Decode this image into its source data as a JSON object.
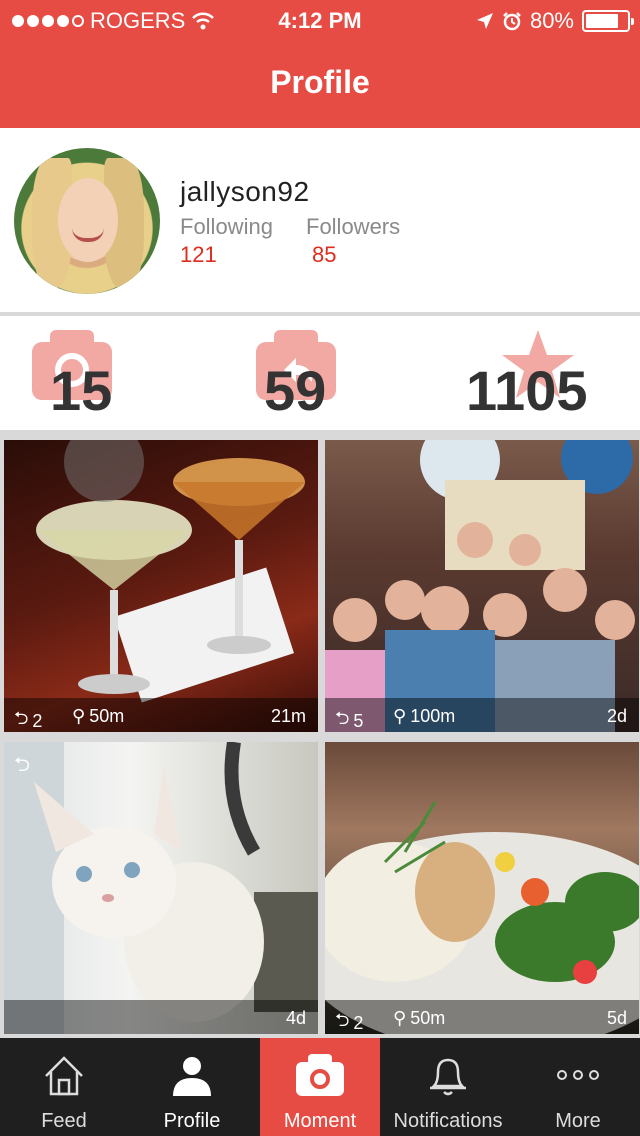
{
  "status": {
    "carrier": "ROGERS",
    "time": "4:12 PM",
    "battery": "80%",
    "battery_level": 0.8
  },
  "header": {
    "title": "Profile"
  },
  "profile": {
    "username": "jallyson92",
    "following_label": "Following",
    "followers_label": "Followers",
    "following_count": "121",
    "followers_count": "85"
  },
  "stats": [
    {
      "icon": "camera-icon",
      "value": "15"
    },
    {
      "icon": "reshare-camera-icon",
      "value": "59"
    },
    {
      "icon": "star-icon",
      "value": "1105"
    }
  ],
  "posts": [
    {
      "subject": "cocktails",
      "reshares": "2",
      "distance": "50m",
      "age": "21m"
    },
    {
      "subject": "group-photo",
      "reshares": "5",
      "distance": "100m",
      "age": "2d"
    },
    {
      "subject": "white-kitten",
      "age": "4d"
    },
    {
      "subject": "food-plate",
      "reshares": "2",
      "distance": "50m",
      "age": "5d"
    }
  ],
  "tabs": [
    {
      "label": "Feed",
      "icon": "home-icon"
    },
    {
      "label": "Profile",
      "icon": "person-icon"
    },
    {
      "label": "Moment",
      "icon": "camera-icon"
    },
    {
      "label": "Notifications",
      "icon": "bell-icon"
    },
    {
      "label": "More",
      "icon": "more-icon"
    }
  ],
  "colors": {
    "accent": "#e64c43",
    "count_red": "#e02b1f",
    "tabbar": "#1f1f1f"
  }
}
